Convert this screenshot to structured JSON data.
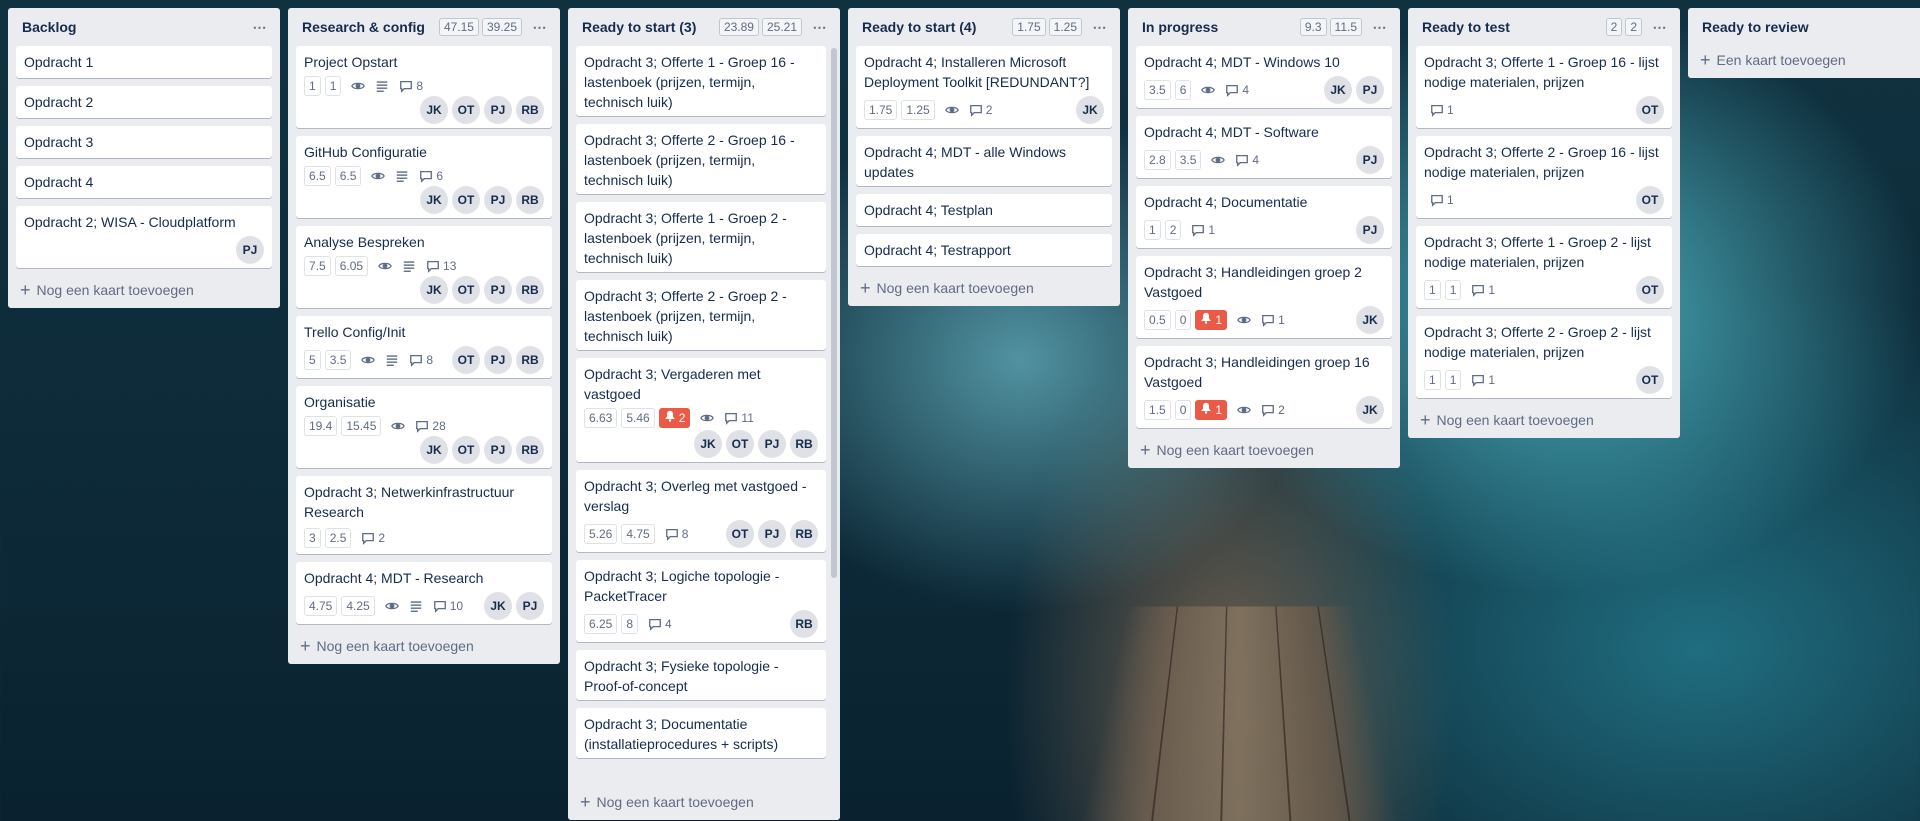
{
  "add_card_label": "Nog een kaart toevoegen",
  "add_first_card_label": "Een kaart toevoegen",
  "lists": [
    {
      "title": "Backlog",
      "badges": [],
      "cards": [
        {
          "title": "Opdracht 1"
        },
        {
          "title": "Opdracht 2"
        },
        {
          "title": "Opdracht 3"
        },
        {
          "title": "Opdracht 4"
        },
        {
          "title": "Opdracht 2; WISA - Cloudplatform",
          "members": [
            "PJ"
          ]
        }
      ]
    },
    {
      "title": "Research & config",
      "badges": [
        "47.15",
        "39.25"
      ],
      "cards": [
        {
          "title": "Project Opstart",
          "nums": [
            "1",
            "1"
          ],
          "watch": true,
          "desc": true,
          "comments": "8",
          "members": [
            "JK",
            "OT",
            "PJ",
            "RB"
          ]
        },
        {
          "title": "GitHub Configuratie",
          "nums": [
            "6.5",
            "6.5"
          ],
          "watch": true,
          "desc": true,
          "comments": "6",
          "members": [
            "JK",
            "OT",
            "PJ",
            "RB"
          ]
        },
        {
          "title": "Analyse Bespreken",
          "nums": [
            "7.5",
            "6.05"
          ],
          "watch": true,
          "desc": true,
          "comments": "13",
          "members": [
            "JK",
            "OT",
            "PJ",
            "RB"
          ]
        },
        {
          "title": "Trello Config/Init",
          "nums": [
            "5",
            "3.5"
          ],
          "watch": true,
          "desc": true,
          "comments": "8",
          "members": [
            "OT",
            "PJ",
            "RB"
          ]
        },
        {
          "title": "Organisatie",
          "nums": [
            "19.4",
            "15.45"
          ],
          "watch": true,
          "comments": "28",
          "members": [
            "JK",
            "OT",
            "PJ",
            "RB"
          ]
        },
        {
          "title": "Opdracht 3; Netwerkinfrastructuur Research",
          "nums": [
            "3",
            "2.5"
          ],
          "comments": "2"
        },
        {
          "title": "Opdracht 4; MDT - Research",
          "nums": [
            "4.75",
            "4.25"
          ],
          "watch": true,
          "desc": true,
          "comments": "10",
          "members": [
            "JK",
            "PJ"
          ]
        }
      ]
    },
    {
      "title": "Ready to start (3)",
      "badges": [
        "23.89",
        "25.21"
      ],
      "scroll": true,
      "cards": [
        {
          "title": "Opdracht 3; Offerte 1 - Groep 16 - lastenboek (prijzen, termijn, technisch luik)"
        },
        {
          "title": "Opdracht 3; Offerte 2 - Groep 16 - lastenboek (prijzen, termijn, technisch luik)"
        },
        {
          "title": "Opdracht 3; Offerte 1 - Groep 2 - lastenboek (prijzen, termijn, technisch luik)"
        },
        {
          "title": "Opdracht 3; Offerte 2 - Groep 2 - lastenboek (prijzen, termijn, technisch luik)"
        },
        {
          "title": "Opdracht 3; Vergaderen met vastgoed",
          "nums": [
            "6.63",
            "5.46"
          ],
          "alert": "2",
          "watch": true,
          "comments": "11",
          "members": [
            "JK",
            "OT",
            "PJ",
            "RB"
          ],
          "wrap": true
        },
        {
          "title": "Opdracht 3; Overleg met vastgoed - verslag",
          "nums": [
            "5.26",
            "4.75"
          ],
          "comments": "8",
          "members": [
            "OT",
            "PJ",
            "RB"
          ]
        },
        {
          "title": "Opdracht 3; Logiche topologie - PacketTracer",
          "nums": [
            "6.25",
            "8"
          ],
          "comments": "4",
          "members": [
            "RB"
          ]
        },
        {
          "title": "Opdracht 3; Fysieke topologie - Proof-of-concept"
        },
        {
          "title": "Opdracht 3; Documentatie (installatieprocedures + scripts)"
        }
      ]
    },
    {
      "title": "Ready to start (4)",
      "badges": [
        "1.75",
        "1.25"
      ],
      "cards": [
        {
          "title": "Opdracht 4; Installeren Microsoft Deployment Toolkit [REDUNDANT?]",
          "nums": [
            "1.75",
            "1.25"
          ],
          "watch": true,
          "comments": "2",
          "members": [
            "JK"
          ]
        },
        {
          "title": "Opdracht 4; MDT - alle Windows updates"
        },
        {
          "title": "Opdracht 4; Testplan"
        },
        {
          "title": "Opdracht 4; Testrapport"
        }
      ]
    },
    {
      "title": "In progress",
      "badges": [
        "9.3",
        "11.5"
      ],
      "cards": [
        {
          "title": "Opdracht 4; MDT - Windows 10",
          "nums": [
            "3.5",
            "6"
          ],
          "watch": true,
          "comments": "4",
          "members": [
            "JK",
            "PJ"
          ]
        },
        {
          "title": "Opdracht 4; MDT - Software",
          "nums": [
            "2.8",
            "3.5"
          ],
          "watch": true,
          "comments": "4",
          "members": [
            "PJ"
          ]
        },
        {
          "title": "Opdracht 4; Documentatie",
          "nums": [
            "1",
            "2"
          ],
          "comments": "1",
          "members": [
            "PJ"
          ]
        },
        {
          "title": "Opdracht 3; Handleidingen groep 2 Vastgoed",
          "nums": [
            "0.5",
            "0"
          ],
          "alert": "1",
          "watch": true,
          "comments": "1",
          "members": [
            "JK"
          ]
        },
        {
          "title": "Opdracht 3; Handleidingen groep 16 Vastgoed",
          "nums": [
            "1.5",
            "0"
          ],
          "alert": "1",
          "watch": true,
          "comments": "2",
          "members": [
            "JK"
          ]
        }
      ]
    },
    {
      "title": "Ready to test",
      "badges": [
        "2",
        "2"
      ],
      "cards": [
        {
          "title": "Opdracht 3; Offerte 1 - Groep 16 - lijst nodige materialen, prijzen",
          "comments": "1",
          "members": [
            "OT"
          ]
        },
        {
          "title": "Opdracht 3; Offerte 2 - Groep 16 - lijst nodige materialen, prijzen",
          "comments": "1",
          "members": [
            "OT"
          ]
        },
        {
          "title": "Opdracht 3; Offerte 1 - Groep 2 - lijst nodige materialen, prijzen",
          "nums": [
            "1",
            "1"
          ],
          "comments": "1",
          "members": [
            "OT"
          ]
        },
        {
          "title": "Opdracht 3; Offerte 2 - Groep 2 - lijst nodige materialen, prijzen",
          "nums": [
            "1",
            "1"
          ],
          "comments": "1",
          "members": [
            "OT"
          ]
        }
      ]
    },
    {
      "title": "Ready to review",
      "badges": [],
      "noMenu": true,
      "empty": true,
      "cards": []
    }
  ]
}
